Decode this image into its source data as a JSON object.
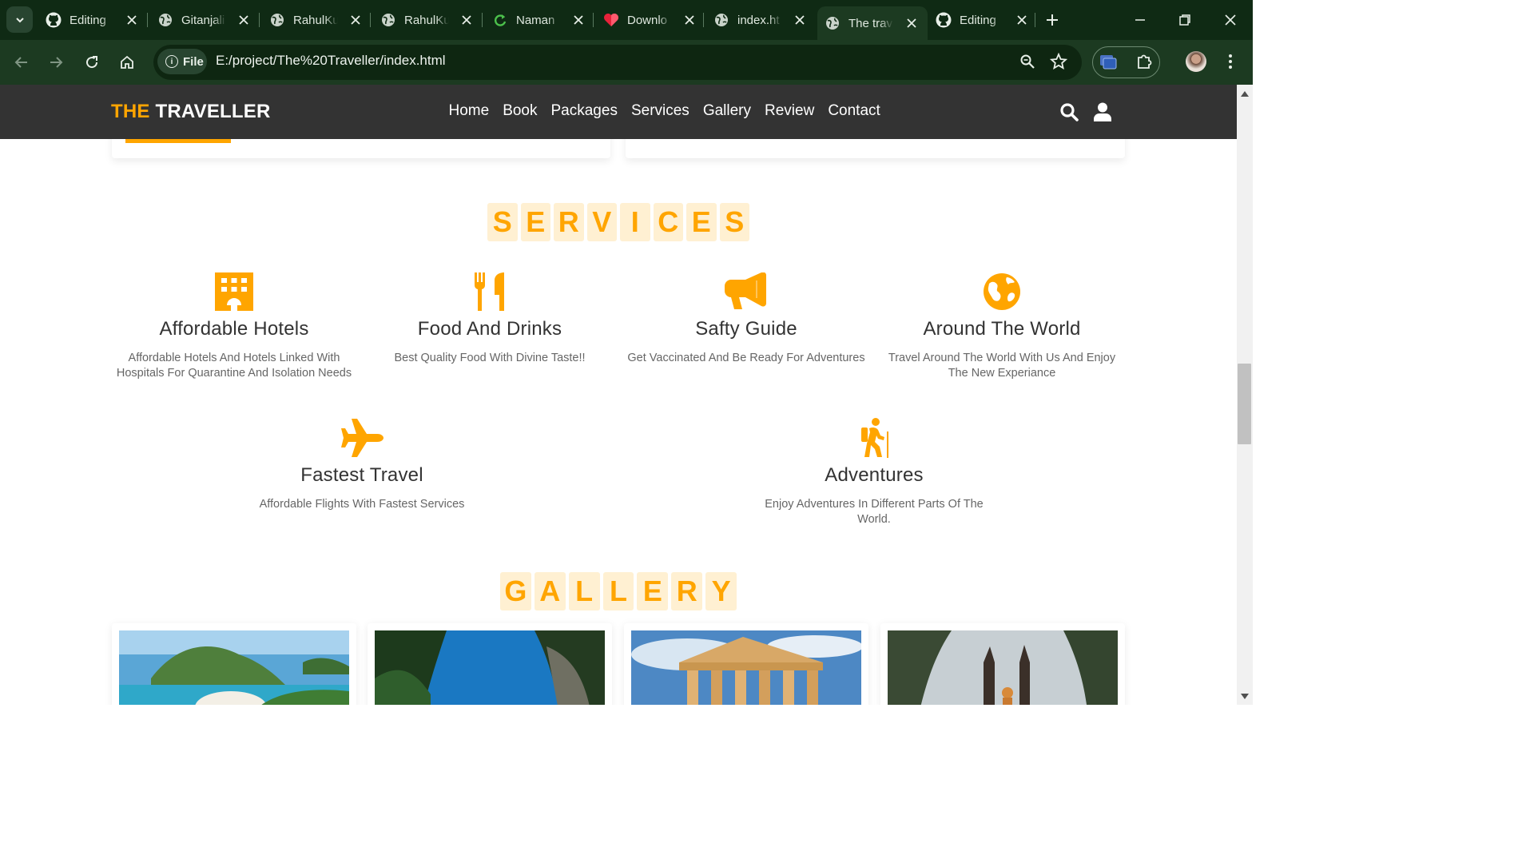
{
  "browser": {
    "tabs": [
      {
        "label": "Editing",
        "icon": "github-icon"
      },
      {
        "label": "Gitanjali",
        "icon": "globe-icon"
      },
      {
        "label": "RahulKu",
        "icon": "globe-icon"
      },
      {
        "label": "RahulKu",
        "icon": "globe-icon"
      },
      {
        "label": "Naman",
        "icon": "refresh-leaf-icon"
      },
      {
        "label": "Downlo",
        "icon": "heart-icon"
      },
      {
        "label": "index.ht",
        "icon": "globe-icon"
      },
      {
        "label": "The trav",
        "icon": "globe-icon",
        "active": true
      },
      {
        "label": "Editing",
        "icon": "github-icon"
      }
    ],
    "chip_label": "File",
    "url": "E:/project/The%20Traveller/index.html"
  },
  "site": {
    "logo_accent": "THE",
    "logo_main": "TRAVELLER",
    "nav": [
      "Home",
      "Book",
      "Packages",
      "Services",
      "Gallery",
      "Review",
      "Contact"
    ],
    "accent_color": "#ffa500"
  },
  "services": {
    "heading_letters": [
      "S",
      "E",
      "R",
      "V",
      "I",
      "C",
      "E",
      "S"
    ],
    "items": [
      {
        "icon": "hotel-icon",
        "title": "Affordable Hotels",
        "desc": "Affordable Hotels And Hotels Linked With Hospitals For Quarantine And Isolation Needs"
      },
      {
        "icon": "utensils-icon",
        "title": "Food And Drinks",
        "desc": "Best Quality Food With Divine Taste!!"
      },
      {
        "icon": "bullhorn-icon",
        "title": "Safty Guide",
        "desc": "Get Vaccinated And Be Ready For Adventures"
      },
      {
        "icon": "globe-icon",
        "title": "Around The World",
        "desc": "Travel Around The World With Us And Enjoy The New Experiance"
      },
      {
        "icon": "plane-icon",
        "title": "Fastest Travel",
        "desc": "Affordable Flights With Fastest Services"
      },
      {
        "icon": "hiking-icon",
        "title": "Adventures",
        "desc": "Enjoy Adventures In Different Parts Of The World."
      }
    ]
  },
  "gallery": {
    "heading_letters": [
      "G",
      "A",
      "L",
      "L",
      "E",
      "R",
      "Y"
    ]
  }
}
